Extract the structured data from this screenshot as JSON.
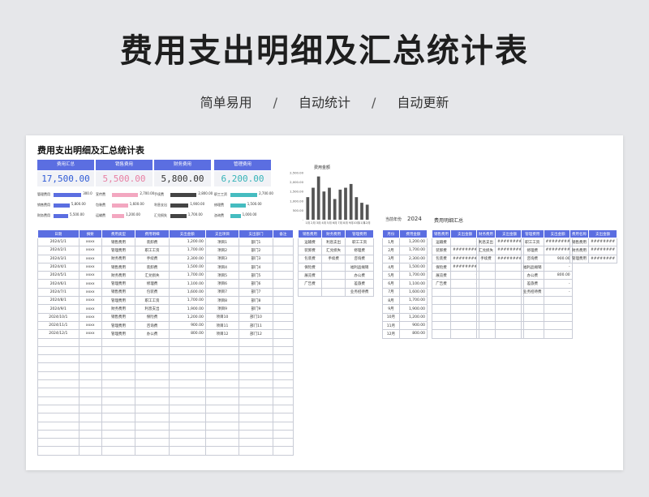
{
  "header": {
    "title": "费用支出明细及汇总统计表",
    "tags": [
      "简单易用",
      "自动统计",
      "自动更新"
    ],
    "sep": "/"
  },
  "sheet": {
    "title": "费用支出明细及汇总统计表",
    "kpis": [
      {
        "label": "费用汇总",
        "value": "17,500.00",
        "color": "#2f5bd6"
      },
      {
        "label": "销售费用",
        "value": "5,500.00",
        "color": "#e87fa3"
      },
      {
        "label": "财务费用",
        "value": "5,800.00",
        "color": "#333333"
      },
      {
        "label": "管理费用",
        "value": "6,200.00",
        "color": "#36b3b8"
      }
    ],
    "mini_charts": [
      {
        "color": "#5b6ee1",
        "rows": [
          {
            "label": "管理费用",
            "value": "300.0",
            "frac": 0.95
          },
          {
            "label": "销售费用",
            "value": "5,800.00",
            "frac": 0.55
          },
          {
            "label": "财务费用",
            "value": "5,500.00",
            "frac": 0.5
          }
        ]
      },
      {
        "color": "#f3a7c0",
        "rows": [
          {
            "label": "宣传费",
            "value": "2,700.00",
            "frac": 0.9
          },
          {
            "label": "包装费",
            "value": "1,600.00",
            "frac": 0.55
          },
          {
            "label": "运输费",
            "value": "1,200.00",
            "frac": 0.42
          }
        ]
      },
      {
        "color": "#444444",
        "rows": [
          {
            "label": "手续费",
            "value": "2,800.00",
            "frac": 0.9
          },
          {
            "label": "利息支出",
            "value": "1,900.00",
            "frac": 0.62
          },
          {
            "label": "汇兑损失",
            "value": "1,700.00",
            "frac": 0.55
          }
        ]
      },
      {
        "color": "#45bcc0",
        "rows": [
          {
            "label": "职工工资",
            "value": "2,700.00",
            "frac": 0.92
          },
          {
            "label": "修理费",
            "value": "1,500.00",
            "frac": 0.52
          },
          {
            "label": "咨询费",
            "value": "1,000.00",
            "frac": 0.35
          }
        ]
      }
    ],
    "main_table": {
      "headers": [
        "日期",
        "摘要",
        "费用类型",
        "费用明细",
        "支出金额",
        "支出项目",
        "支出部门",
        "备注"
      ],
      "rows": [
        [
          "2024/1/1",
          "xxxx",
          "销售费用",
          "装卸费",
          "1,200.00",
          "项目1",
          "部门1",
          ""
        ],
        [
          "2024/2/1",
          "xxxx",
          "管理费用",
          "职工工资",
          "1,700.00",
          "项目2",
          "部门2",
          ""
        ],
        [
          "2024/3/1",
          "xxxx",
          "财务费用",
          "手续费",
          "2,300.00",
          "项目3",
          "部门3",
          ""
        ],
        [
          "2024/4/1",
          "xxxx",
          "销售费用",
          "装卸费",
          "1,500.00",
          "项目4",
          "部门4",
          ""
        ],
        [
          "2024/5/1",
          "xxxx",
          "财务费用",
          "汇兑损失",
          "1,700.00",
          "项目5",
          "部门5",
          ""
        ],
        [
          "2024/6/1",
          "xxxx",
          "管理费用",
          "修理费",
          "1,100.00",
          "项目6",
          "部门6",
          ""
        ],
        [
          "2024/7/1",
          "xxxx",
          "销售费用",
          "包装费",
          "1,600.00",
          "项目7",
          "部门7",
          ""
        ],
        [
          "2024/8/1",
          "xxxx",
          "管理费用",
          "职工工资",
          "1,700.00",
          "项目8",
          "部门8",
          ""
        ],
        [
          "2024/9/1",
          "xxxx",
          "财务费用",
          "利息支出",
          "1,900.00",
          "项目9",
          "部门9",
          ""
        ],
        [
          "2024/10/1",
          "xxxx",
          "销售费用",
          "保险费",
          "1,200.00",
          "项目10",
          "部门10",
          ""
        ],
        [
          "2024/11/1",
          "xxxx",
          "管理费用",
          "咨询费",
          "900.00",
          "项目11",
          "部门11",
          ""
        ],
        [
          "2024/12/1",
          "xxxx",
          "管理费用",
          "办公费",
          "800.00",
          "项目12",
          "部门12",
          ""
        ]
      ],
      "empty_rows": 14
    },
    "category_table": {
      "headers": [
        "销售费用",
        "财务费用",
        "管理费用"
      ],
      "rows": [
        [
          "运输费",
          "利息支出",
          "职工工资"
        ],
        [
          "装卸费",
          "汇兑损失",
          "修理费"
        ],
        [
          "包装费",
          "手续费",
          "咨询费"
        ],
        [
          "保险费",
          "",
          "福利品摊销"
        ],
        [
          "展览费",
          "",
          "办公费"
        ],
        [
          "广告费",
          "",
          "差旅费"
        ],
        [
          "",
          "",
          "业务招待费"
        ]
      ]
    },
    "line_chart": {
      "title": "费用金额",
      "yticks": [
        "2,500.00",
        "2,000.00",
        "1,500.00",
        "1,000.00",
        "500.00",
        "-"
      ]
    },
    "meta": {
      "year_label": "当前年份",
      "year": "2024",
      "summary_title": "费用明细汇总"
    },
    "monthly_table": {
      "headers": [
        "月份",
        "费用金额"
      ],
      "rows": [
        [
          "1月",
          "1,200.00"
        ],
        [
          "2月",
          "1,700.00"
        ],
        [
          "3月",
          "2,300.00"
        ],
        [
          "4月",
          "1,500.00"
        ],
        [
          "5月",
          "1,700.00"
        ],
        [
          "6月",
          "1,100.00"
        ],
        [
          "7月",
          "1,600.00"
        ],
        [
          "8月",
          "1,700.00"
        ],
        [
          "9月",
          "1,900.00"
        ],
        [
          "10月",
          "1,200.00"
        ],
        [
          "11月",
          "900.00"
        ],
        [
          "12月",
          "800.00"
        ]
      ]
    },
    "sales_table": {
      "headers": [
        "销售费用",
        "支出金额"
      ],
      "rows": [
        [
          "运输费",
          "-"
        ],
        [
          "装卸费",
          "########"
        ],
        [
          "包装费",
          "########"
        ],
        [
          "保险费",
          "########"
        ],
        [
          "展览费",
          "-"
        ],
        [
          "广告费",
          "-"
        ]
      ]
    },
    "finance_table": {
      "headers": [
        "财务费用",
        "支出金额"
      ],
      "rows": [
        [
          "利息支出",
          "########"
        ],
        [
          "汇兑损失",
          "########"
        ],
        [
          "手续费",
          "########"
        ]
      ]
    },
    "admin_table": {
      "headers": [
        "管理费用",
        "支出金额"
      ],
      "rows": [
        [
          "职工工资",
          "########"
        ],
        [
          "修理费",
          "########"
        ],
        [
          "咨询费",
          "900.00"
        ],
        [
          "福利品摊销",
          "-"
        ],
        [
          "办公费",
          "800.00"
        ],
        [
          "差旅费",
          "-"
        ],
        [
          "业务招待费",
          "-"
        ]
      ]
    },
    "type_table": {
      "headers": [
        "费用名称",
        "支出金额"
      ],
      "rows": [
        [
          "销售费用",
          "########"
        ],
        [
          "财务费用",
          "########"
        ],
        [
          "管理费用",
          "########"
        ]
      ]
    }
  },
  "chart_data": {
    "type": "bar",
    "title": "费用金额",
    "categories": [
      "1月",
      "2月",
      "3月",
      "4月",
      "5月",
      "6月",
      "7月",
      "8月",
      "9月",
      "10月",
      "11月",
      "12月"
    ],
    "values": [
      1200,
      1700,
      2300,
      1500,
      1700,
      1100,
      1600,
      1700,
      1900,
      1200,
      900,
      800
    ],
    "ylim": [
      0,
      2500
    ],
    "color": "#555555"
  }
}
